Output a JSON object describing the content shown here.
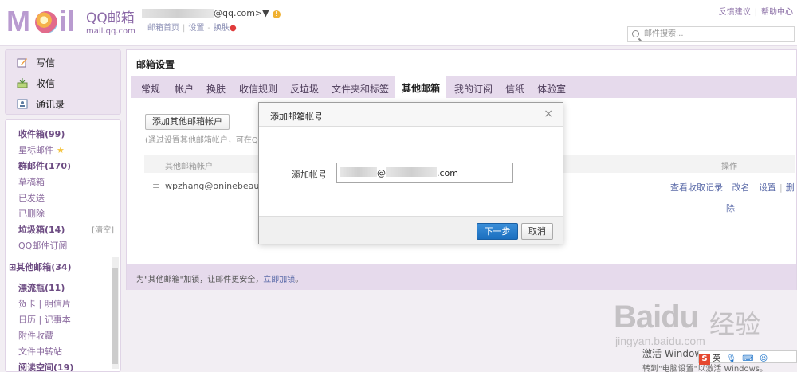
{
  "header": {
    "logo_text": "M●il",
    "brand_title": "QQ邮箱",
    "brand_sub": "mail.qq.com",
    "account_suffix": "@qq.com>▼",
    "warn_icon": "!",
    "links": [
      "邮箱首页",
      "设置",
      "换肤"
    ],
    "right_links": [
      "反馈建议",
      "帮助中心"
    ],
    "search_placeholder": "邮件搜索..."
  },
  "sidebar": {
    "write": "写信",
    "receive": "收信",
    "contacts": "通讯录",
    "folders": [
      {
        "label": "收件箱(99)",
        "bold": true
      },
      {
        "label": "星标邮件",
        "bold": false
      },
      {
        "label": "群邮件(170)",
        "bold": true
      },
      {
        "label": "草稿箱",
        "bold": false
      },
      {
        "label": "已发送",
        "bold": false
      },
      {
        "label": "已删除",
        "bold": false
      },
      {
        "label": "垃圾箱(14)",
        "bold": true
      },
      {
        "label": "QQ邮件订阅",
        "bold": false
      },
      {
        "label": "⊞其他邮箱(34)",
        "bold": true
      },
      {
        "label": "漂流瓶(11)",
        "bold": true
      },
      {
        "label": "贺卡 | 明信片",
        "bold": false
      },
      {
        "label": "日历 | 记事本",
        "bold": false
      },
      {
        "label": "附件收藏",
        "bold": false
      },
      {
        "label": "文件中转站",
        "bold": false
      },
      {
        "label": "阅读空间(19)",
        "bold": true
      }
    ],
    "clear": "[清空]"
  },
  "main": {
    "title": "邮箱设置",
    "tabs": [
      "常规",
      "帐户",
      "换肤",
      "收信规则",
      "反垃圾",
      "文件夹和标签",
      "其他邮箱",
      "我的订阅",
      "信纸",
      "体验室"
    ],
    "active_tab": "其他邮箱",
    "add_button": "添加其他邮箱帐户",
    "hint": "(通过设置其他邮箱帐户，可在Q",
    "col_account": "其他邮箱帐户",
    "col_ops": "操作",
    "row_email": "wpzhang@oninebeauty",
    "row_actions": [
      "查看收取记录",
      "改名",
      "设置",
      "删"
    ],
    "row_delete_tail": "除",
    "lock_text": "为\"其他邮箱\"加锁，让邮件更安全，",
    "lock_link": "立即加锁",
    "lock_end": "。"
  },
  "modal": {
    "title": "添加邮箱帐号",
    "close": "×",
    "label": "添加帐号",
    "value_at": "@",
    "value_tld": ".com",
    "next": "下一步",
    "cancel": "取消"
  },
  "watermark": {
    "logo": "Bai",
    "logo_du": "du",
    "cn": "经验",
    "url": "jingyan.baidu.com"
  },
  "system": {
    "activate": "激活 Windows",
    "activate_sub": "转到\"电脑设置\"以激活 Windows。",
    "ime_s": "S",
    "ime_lang": "英"
  }
}
